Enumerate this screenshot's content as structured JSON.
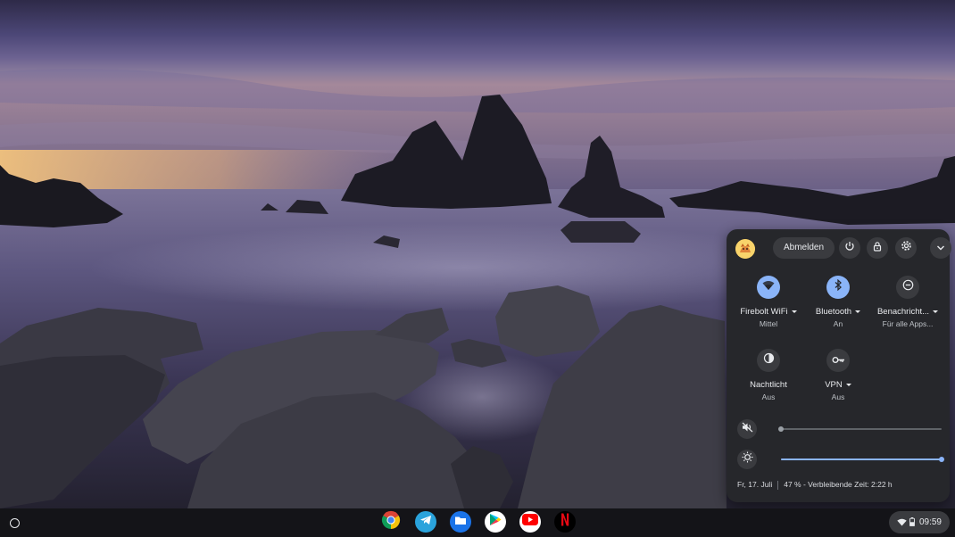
{
  "quick_settings": {
    "signout_label": "Abmelden",
    "top_icons": [
      "power-icon",
      "lock-icon",
      "settings-icon",
      "collapse-chevron-icon"
    ],
    "tiles": [
      {
        "label": "Firebolt WiFi",
        "sublabel": "Mittel",
        "icon": "wifi-icon",
        "active": true,
        "has_menu": true
      },
      {
        "label": "Bluetooth",
        "sublabel": "An",
        "icon": "bluetooth-icon",
        "active": true,
        "has_menu": true
      },
      {
        "label": "Benachricht...",
        "sublabel": "Für alle Apps...",
        "icon": "do-not-disturb-icon",
        "active": false,
        "has_menu": true
      },
      {
        "label": "Nachtlicht",
        "sublabel": "Aus",
        "icon": "night-light-icon",
        "active": false,
        "has_menu": false
      },
      {
        "label": "VPN",
        "sublabel": "Aus",
        "icon": "vpn-key-icon",
        "active": false,
        "has_menu": true
      }
    ],
    "volume": {
      "icon": "volume-muted-icon",
      "level": 0.0,
      "muted": true
    },
    "brightness": {
      "icon": "brightness-icon",
      "level": 1.0
    },
    "date": "Fr, 17. Juli",
    "battery": "47 % - Verbleibende Zeit: 2:22 h"
  },
  "shelf": {
    "launcher_icon": "launcher-icon",
    "apps": [
      "Chrome",
      "Telegram",
      "Dateien",
      "Play Store",
      "YouTube",
      "Netflix"
    ],
    "status": {
      "wifi_icon": "wifi-icon",
      "battery_icon": "battery-icon",
      "time": "09:59"
    }
  },
  "colors": {
    "accent": "#8ab4f8",
    "panel": "#26272b",
    "shelf": "#141418"
  }
}
